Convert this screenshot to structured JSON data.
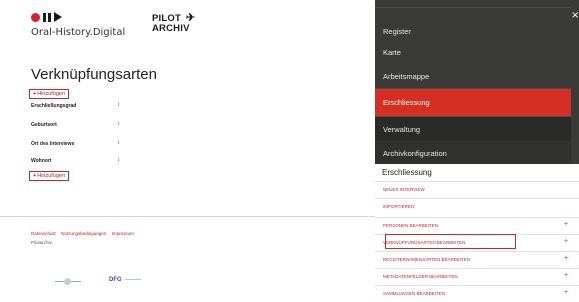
{
  "header": {
    "logo_text": "Oral-History.Digital",
    "pilot_line1": "PILOT",
    "pilot_line2": "ARCHIV",
    "plane_icon": "✈"
  },
  "main": {
    "page_title": "Verknüpfungsarten",
    "add_button_label": "Hinzufügen",
    "add_button_symbol": "+",
    "drag_symbol": "↕",
    "types": [
      {
        "label": "Erschließungsgrad"
      },
      {
        "label": "Geburtsort"
      },
      {
        "label": "Ort des Interviews"
      },
      {
        "label": "Wohnort"
      }
    ]
  },
  "footer": {
    "links": [
      "Datenschutz",
      "Nutzungsbedingungen",
      "Impressum"
    ],
    "subtext": "Pilotarchiv",
    "sponsor2": "DFG"
  },
  "panel": {
    "close_symbol": "×",
    "menu_items": [
      {
        "label": "Register"
      },
      {
        "label": "Karte"
      },
      {
        "label": "Arbeitsmappe"
      },
      {
        "label": "Erschliessung"
      },
      {
        "label": "Verwaltung"
      },
      {
        "label": "Archivkonfiguration"
      }
    ],
    "submenu_title": "Erschliessung",
    "submenu_items": [
      {
        "label": "NEUES INTERVIEW",
        "plus": ""
      },
      {
        "label": "IMPORTIEREN",
        "plus": ""
      },
      {
        "label": "PERSONEN BEARBEITEN",
        "plus": "+"
      },
      {
        "label": "VERKNÜPFUNGSARTEN BEARBEITEN",
        "plus": "+"
      },
      {
        "label": "REGISTERNAMENSARTEN BEARBEITEN",
        "plus": "+"
      },
      {
        "label": "METADATENFELDER BEARBEITEN",
        "plus": "+"
      },
      {
        "label": "SAMMLUNGEN BEARBEITEN",
        "plus": "+"
      }
    ]
  },
  "colors": {
    "accent_red": "#d42f22",
    "panel_dark": "#3a3a38",
    "link_red": "#c4262e"
  }
}
